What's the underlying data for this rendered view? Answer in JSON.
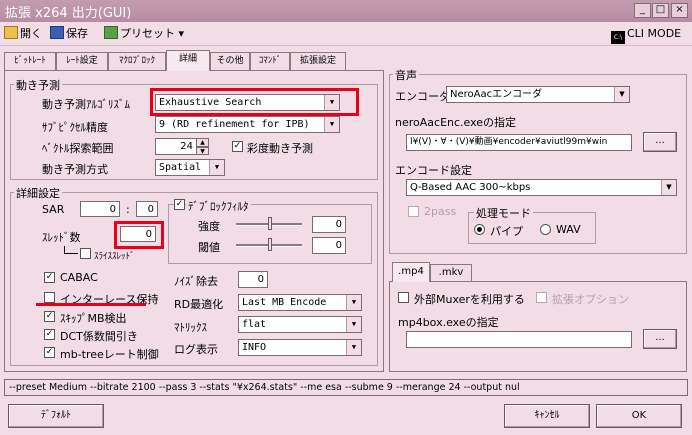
{
  "window": {
    "title": "拡張 x264 出力(GUI)",
    "min": "_",
    "max": "□",
    "close": "×"
  },
  "toolbar": {
    "open": "開く",
    "save": "保存",
    "preset": "プリセット",
    "preset_arrow": "▾",
    "cli_icon": "C:\\",
    "cli": "CLI MODE"
  },
  "tabs": [
    "ﾋﾞｯﾄﾚｰﾄ",
    "ﾚｰﾄ設定",
    "ﾏｸﾛﾌﾞﾛｯｸ",
    "詳細",
    "その他",
    "ｺﾏﾝﾄﾞ",
    "拡張設定"
  ],
  "motion": {
    "group": "動き予測",
    "algo_label": "動き予測ｱﾙｺﾞﾘｽﾞﾑ",
    "algo_value": "Exhaustive Search",
    "subpel_label": "ｻﾌﾞﾋﾟｸｾﾙ精度",
    "subpel_value": "9 (RD refinement for IPB)",
    "range_label": "ﾍﾞｸﾄﾙ探索範囲",
    "range_value": "24",
    "chroma_label": "彩度動き予測",
    "chroma_checked": "✓",
    "mode_label": "動き予測方式",
    "mode_value": "Spatial"
  },
  "detail": {
    "group": "詳細設定",
    "sar_label": "SAR",
    "sar_w": "0",
    "sar_sep": ":",
    "sar_h": "0",
    "threads_label": "ｽﾚｯﾄﾞ数",
    "threads_value": "0",
    "sliced_label": "ｽﾗｲｽｽﾚｯﾄﾞ",
    "deblock_label": "ﾃﾞﾌﾞﾛｯｸﾌｨﾙﾀ",
    "deblock_checked": "✓",
    "strength_label": "強度",
    "strength_value": "0",
    "threshold_label": "閾値",
    "threshold_value": "0",
    "cabac_label": "CABAC",
    "cabac_checked": "✓",
    "interlace_label": "インターレース保持",
    "skip_label": "ｽｷｯﾌﾟMB検出",
    "skip_checked": "✓",
    "dct_label": "DCT係数間引き",
    "dct_checked": "✓",
    "mbtree_label": "mb-treeレート制御",
    "mbtree_checked": "✓",
    "nr_label": "ﾉｲｽﾞ除去",
    "nr_value": "0",
    "rdo_label": "RD最適化",
    "rdo_value": "Last MB Encode",
    "matrix_label": "ﾏﾄﾘｯｸｽ",
    "matrix_value": "flat",
    "log_label": "ログ表示",
    "log_value": "INFO"
  },
  "audio": {
    "group": "音声",
    "encoder_label": "エンコーダ",
    "encoder_value": "NeroAacエンコーダ",
    "path_label": "neroAacEnc.exeの指定",
    "path_value": "I¥(V)・∀・(V)¥動画¥encoder¥aviutl99m¥win",
    "browse": "...",
    "setting_label": "エンコード設定",
    "setting_value": "Q-Based AAC 300~kbps",
    "twopass_label": "2pass",
    "mode_group": "処理モード",
    "pipe_label": "パイプ",
    "wav_label": "WAV"
  },
  "mux": {
    "tabs": [
      ".mp4",
      ".mkv"
    ],
    "external_label": "外部Muxerを利用する",
    "ext_option": "拡張オプション",
    "mp4box_label": "mp4box.exeの指定",
    "mp4box_value": "",
    "browse": "..."
  },
  "cmdline": "--preset Medium --bitrate 2100 --pass 3 --stats \"¥x264.stats\" --me esa --subme 9 --merange 24 --output nul",
  "footer": {
    "default": "ﾃﾞﾌｫﾙﾄ",
    "cancel": "ｷｬﾝｾﾙ",
    "ok": "OK"
  },
  "colors": {
    "background": "#f2dde6",
    "highlight": "#e8001c"
  }
}
